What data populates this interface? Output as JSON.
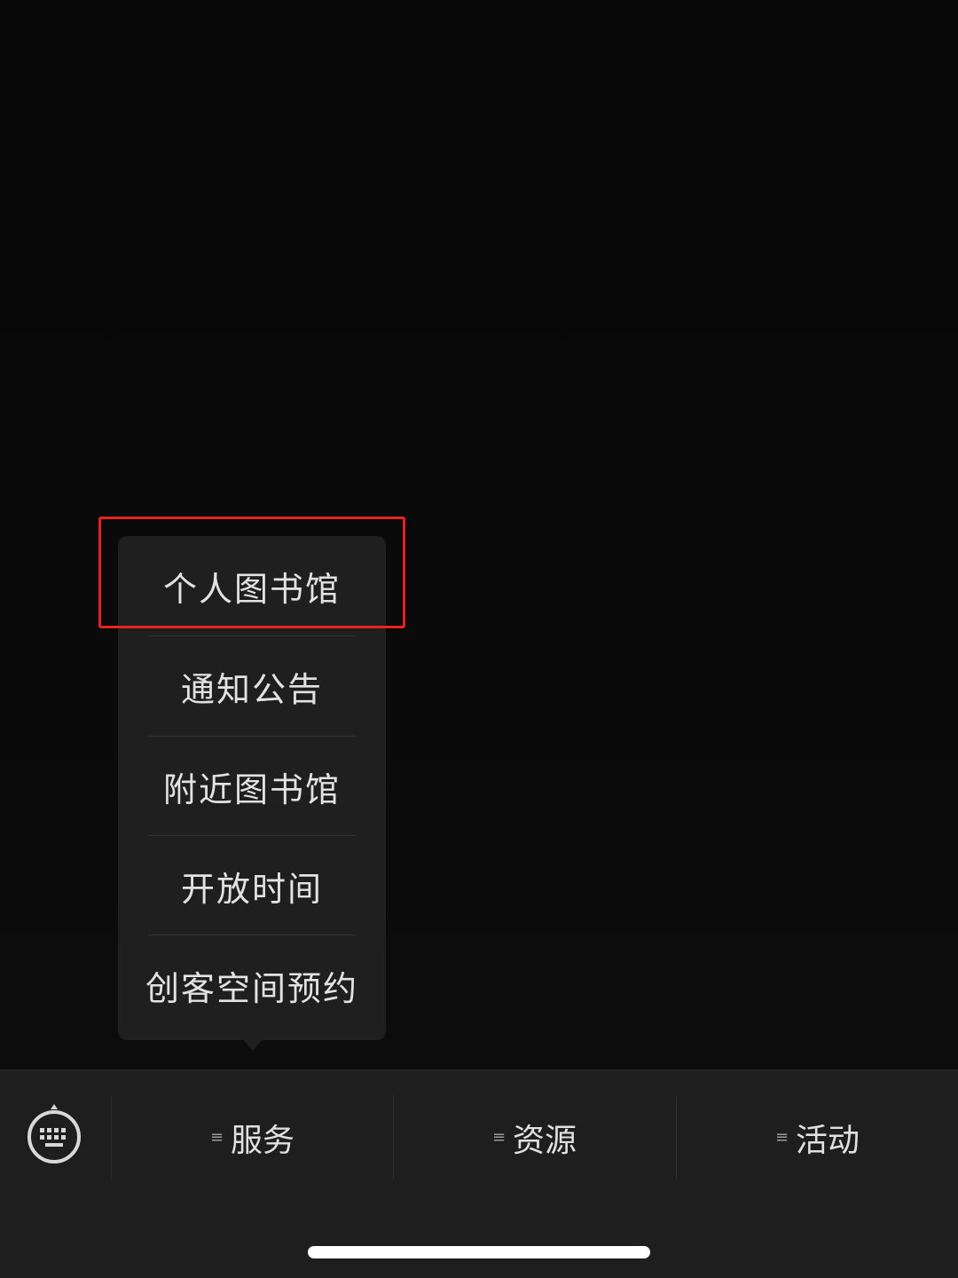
{
  "popup_menu": {
    "items": [
      {
        "label": "个人图书馆"
      },
      {
        "label": "通知公告"
      },
      {
        "label": "附近图书馆"
      },
      {
        "label": "开放时间"
      },
      {
        "label": "创客空间预约"
      }
    ]
  },
  "bottom_bar": {
    "keyboard_icon": "keyboard-icon",
    "tabs": [
      {
        "label": "服务",
        "icon": "menu-lines-icon"
      },
      {
        "label": "资源",
        "icon": "menu-lines-icon"
      },
      {
        "label": "活动",
        "icon": "menu-lines-icon"
      }
    ]
  },
  "colors": {
    "background": "#000000",
    "menu_background": "#1f1f1f",
    "highlight": "#e8231f",
    "bar_background": "#1e1e1e"
  }
}
